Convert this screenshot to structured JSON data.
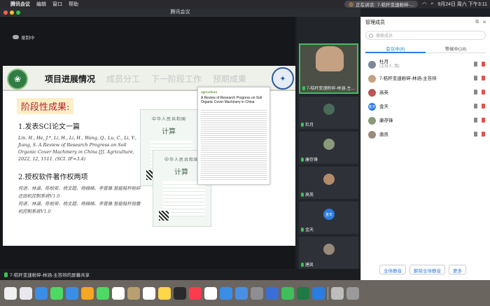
{
  "menubar": {
    "app": "腾讯会议",
    "items": [
      "编辑",
      "窗口",
      "帮助"
    ],
    "speaker_prefix": "正在讲话:",
    "speaker_name": "7-秸秆变速粉碎-...",
    "date_time": "9月24日 周六 下午3:11"
  },
  "window": {
    "title": "腾讯会议"
  },
  "stage": {
    "recording": "录制中",
    "share_label": "7-秸秆变速粉碎-林涵-主答辩的屏幕共享"
  },
  "slide": {
    "nav": [
      "项目进展情况",
      "成员分工",
      "下一阶段工作",
      "预期成果"
    ],
    "logo_left_text": "中国农业大学",
    "stage_title": "阶段性成果:",
    "section1": "1.发表SCI论文一篇",
    "citation": "Lin. H., He, J.*, Li, H., Li, H., Wang, Q., Lu, C., Li, Y., Jiang, S. A Review of Research Progress on Soil Organic Cover Machinery in China [J]. Agriculture, 2022, 12, 1511. (SCI. IF=3.4)",
    "section2": "2.授权软件著作权两项",
    "software": [
      "何进、林涵、陈柏安、杨文超、杨楠楠、李晋雅.智能秸秆粉碎还田机控制系统V1.0",
      "何进、林涵、陈柏安、杨文超、杨楠楠、李晋雅.智能秸秆抛撒机控制系统V1.0"
    ],
    "cert_header": "中华人民共和国",
    "cert_big": "计算",
    "paper_journal": "agriculture",
    "paper_title": "A Review of Research Progress on Soil Organic Cover Machinery in China"
  },
  "thumbnails": [
    {
      "label": "7-秸秆变速粉碎-林涵-主...",
      "active": true
    },
    {
      "label": "杜月"
    },
    {
      "label": "康存锋"
    },
    {
      "label": "高英"
    },
    {
      "label": "金天"
    },
    {
      "label": "唐凯"
    }
  ],
  "panel": {
    "title": "管理成员",
    "search_placeholder": "搜索成员",
    "tabs": [
      "会议中(8)",
      "等候中(18)"
    ],
    "members": [
      {
        "name": "杜月",
        "sub": "(主持人, 我)",
        "avatar": "#7a8a9a"
      },
      {
        "name": "7-秸秆变速粉碎-林涵-主答辩",
        "sub": "",
        "avatar": "#c4a183"
      },
      {
        "name": "高英",
        "sub": "",
        "avatar": "#b55"
      },
      {
        "name": "金天",
        "sub": "",
        "avatar": "#2a7de1",
        "initial": "金天"
      },
      {
        "name": "康存锋",
        "sub": "",
        "avatar": "#8a9a7a"
      },
      {
        "name": "唐凯",
        "sub": "",
        "avatar": "#9a8a7a"
      }
    ],
    "actions": [
      "全体静音",
      "解除全体静音",
      "更多"
    ]
  }
}
